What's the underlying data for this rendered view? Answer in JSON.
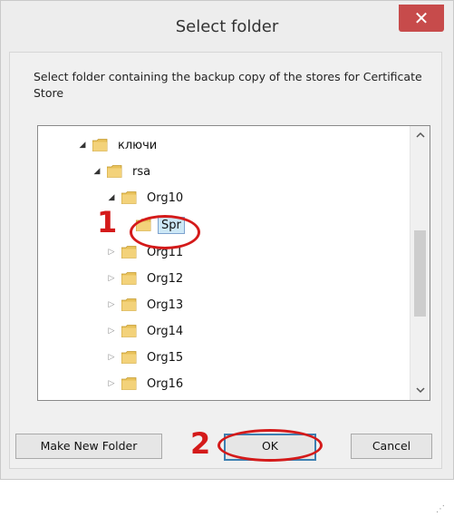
{
  "dialog": {
    "title": "Select folder",
    "close_glyph": "✕",
    "description": "Select folder containing the backup copy of the stores for Certificate Store"
  },
  "tree": {
    "items": [
      {
        "label": "ключи",
        "expanded": true,
        "level": 0
      },
      {
        "label": "rsa",
        "expanded": true,
        "level": 1
      },
      {
        "label": "Org10",
        "expanded": true,
        "level": 2
      },
      {
        "label": "Spr",
        "expanded": false,
        "level": 3,
        "selected": true
      },
      {
        "label": "Org11",
        "expanded": false,
        "level": 2
      },
      {
        "label": "Org12",
        "expanded": false,
        "level": 2
      },
      {
        "label": "Org13",
        "expanded": false,
        "level": 2
      },
      {
        "label": "Org14",
        "expanded": false,
        "level": 2
      },
      {
        "label": "Org15",
        "expanded": false,
        "level": 2
      },
      {
        "label": "Org16",
        "expanded": false,
        "level": 2
      }
    ],
    "scroll_up_icon": "chevron-up-icon",
    "scroll_down_icon": "chevron-down-icon"
  },
  "buttons": {
    "make_new_folder": "Make New Folder",
    "ok": "OK",
    "cancel": "Cancel"
  },
  "annotations": {
    "marker_1": "1",
    "marker_2": "2",
    "color": "#d41a1a"
  },
  "colors": {
    "close_button": "#c74b4b",
    "selection": "#cde8f6",
    "folder": "#e8c15a"
  }
}
